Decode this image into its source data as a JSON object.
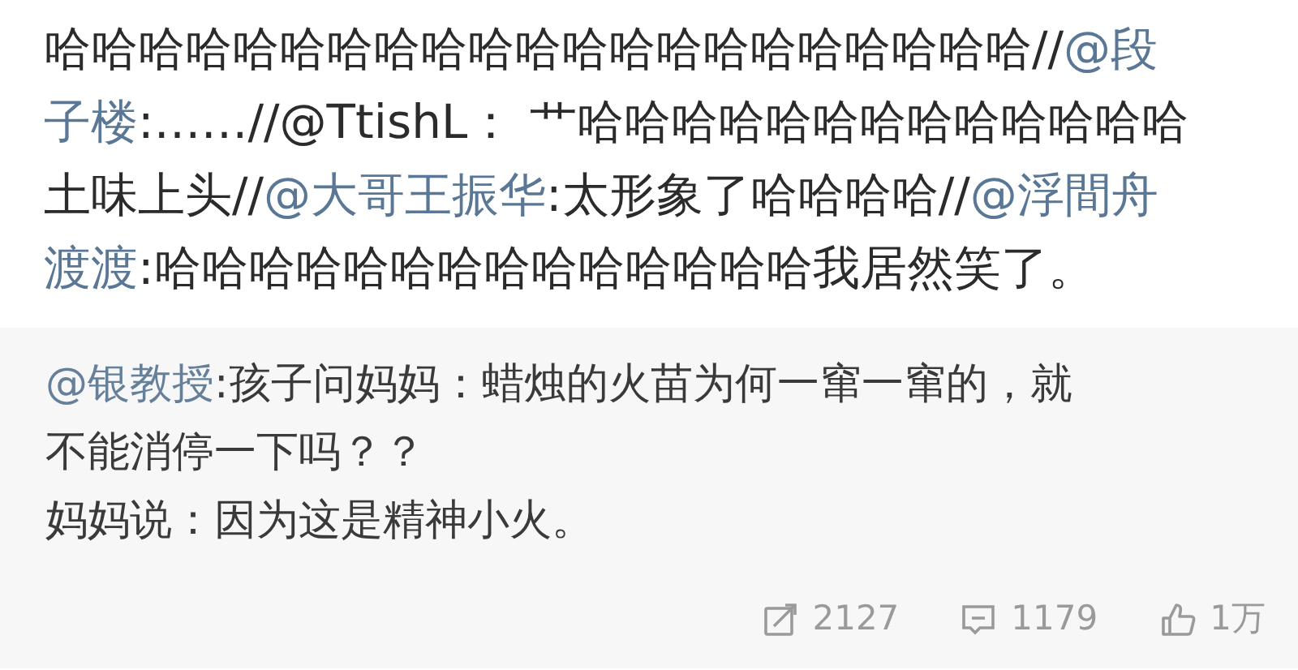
{
  "post": {
    "lines": [
      [
        {
          "kind": "text",
          "text": "哈哈哈哈哈哈哈哈哈哈哈哈哈哈哈哈哈哈哈哈哈//"
        },
        {
          "kind": "mention",
          "text": "@段"
        }
      ],
      [
        {
          "kind": "mention",
          "text": "子楼"
        },
        {
          "kind": "text",
          "text": ":……//@TtishL： 艹哈哈哈哈哈哈哈哈哈哈哈哈哈"
        }
      ],
      [
        {
          "kind": "text",
          "text": "土味上头//"
        },
        {
          "kind": "mention",
          "text": "@大哥王振华"
        },
        {
          "kind": "text",
          "text": ":太形象了哈哈哈哈//"
        },
        {
          "kind": "mention",
          "text": "@浮間舟"
        }
      ],
      [
        {
          "kind": "mention",
          "text": "渡渡"
        },
        {
          "kind": "text",
          "text": ":哈哈哈哈哈哈哈哈哈哈哈哈哈哈我居然笑了。"
        }
      ]
    ]
  },
  "original": {
    "lines": [
      [
        {
          "kind": "mention",
          "text": "@银教授"
        },
        {
          "kind": "text",
          "text": ":孩子问妈妈：蜡烛的火苗为何一窜一窜的，就"
        }
      ],
      [
        {
          "kind": "text",
          "text": "不能消停一下吗？？"
        }
      ],
      [
        {
          "kind": "text",
          "text": "妈妈说：因为这是精神小火。"
        }
      ]
    ],
    "actions": [
      {
        "kind": "repost",
        "count": "2127"
      },
      {
        "kind": "comment",
        "count": "1179"
      },
      {
        "kind": "like",
        "count": "1万"
      }
    ]
  }
}
